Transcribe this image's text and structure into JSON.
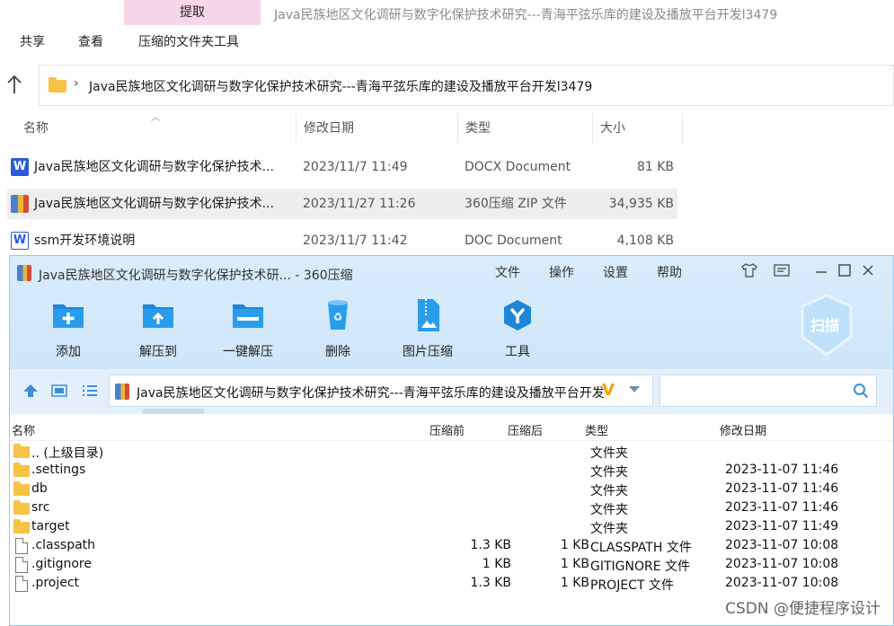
{
  "explorer": {
    "extract_tab": "提取",
    "window_title": "Java民族地区文化调研与数字化保护技术研究---青海平弦乐库的建设及播放平台开发l3479",
    "ribbon_tabs": [
      "共享",
      "查看",
      "压缩的文件夹工具"
    ],
    "address": "Java民族地区文化调研与数字化保护技术研究---青海平弦乐库的建设及播放平台开发l3479",
    "columns": [
      "名称",
      "修改日期",
      "类型",
      "大小"
    ],
    "files": [
      {
        "name": "Java民族地区文化调研与数字化保护技术...",
        "date": "2023/11/7 11:49",
        "type": "DOCX Document",
        "size": "81 KB",
        "icon": "word-icon"
      },
      {
        "name": "Java民族地区文化调研与数字化保护技术...",
        "date": "2023/11/27 11:26",
        "type": "360压缩 ZIP 文件",
        "size": "34,935 KB",
        "icon": "zip-icon"
      },
      {
        "name": "ssm开发环境说明",
        "date": "2023/11/7 11:42",
        "type": "DOC Document",
        "size": "4,108 KB",
        "icon": "word-doc-icon"
      }
    ]
  },
  "zip": {
    "title": "Java民族地区文化调研与数字化保护技术研... - 360压缩",
    "menu": [
      "文件",
      "操作",
      "设置",
      "帮助"
    ],
    "tools": [
      "添加",
      "解压到",
      "一键解压",
      "删除",
      "图片压缩",
      "工具"
    ],
    "scan_label": "扫描",
    "path": "Java民族地区文化调研与数字化保护技术研究---青海平弦乐库的建设及播放平台开发",
    "columns": [
      "名称",
      "压缩前",
      "压缩后",
      "类型",
      "修改日期"
    ],
    "rows": [
      {
        "name": ".. (上级目录)",
        "before": "",
        "after": "",
        "type": "文件夹",
        "date": "",
        "kind": "folder"
      },
      {
        "name": ".settings",
        "before": "",
        "after": "",
        "type": "文件夹",
        "date": "2023-11-07 11:46",
        "kind": "folder"
      },
      {
        "name": "db",
        "before": "",
        "after": "",
        "type": "文件夹",
        "date": "2023-11-07 11:46",
        "kind": "folder"
      },
      {
        "name": "src",
        "before": "",
        "after": "",
        "type": "文件夹",
        "date": "2023-11-07 11:46",
        "kind": "folder"
      },
      {
        "name": "target",
        "before": "",
        "after": "",
        "type": "文件夹",
        "date": "2023-11-07 11:49",
        "kind": "folder"
      },
      {
        "name": ".classpath",
        "before": "1.3 KB",
        "after": "1 KB",
        "type": "CLASSPATH 文件",
        "date": "2023-11-07 10:08",
        "kind": "file"
      },
      {
        "name": ".gitignore",
        "before": "1 KB",
        "after": "1 KB",
        "type": "GITIGNORE 文件",
        "date": "2023-11-07 10:08",
        "kind": "file"
      },
      {
        "name": ".project",
        "before": "1.3 KB",
        "after": "1 KB",
        "type": "PROJECT 文件",
        "date": "2023-11-07 10:08",
        "kind": "file"
      }
    ]
  },
  "watermark": "CSDN @便捷程序设计"
}
